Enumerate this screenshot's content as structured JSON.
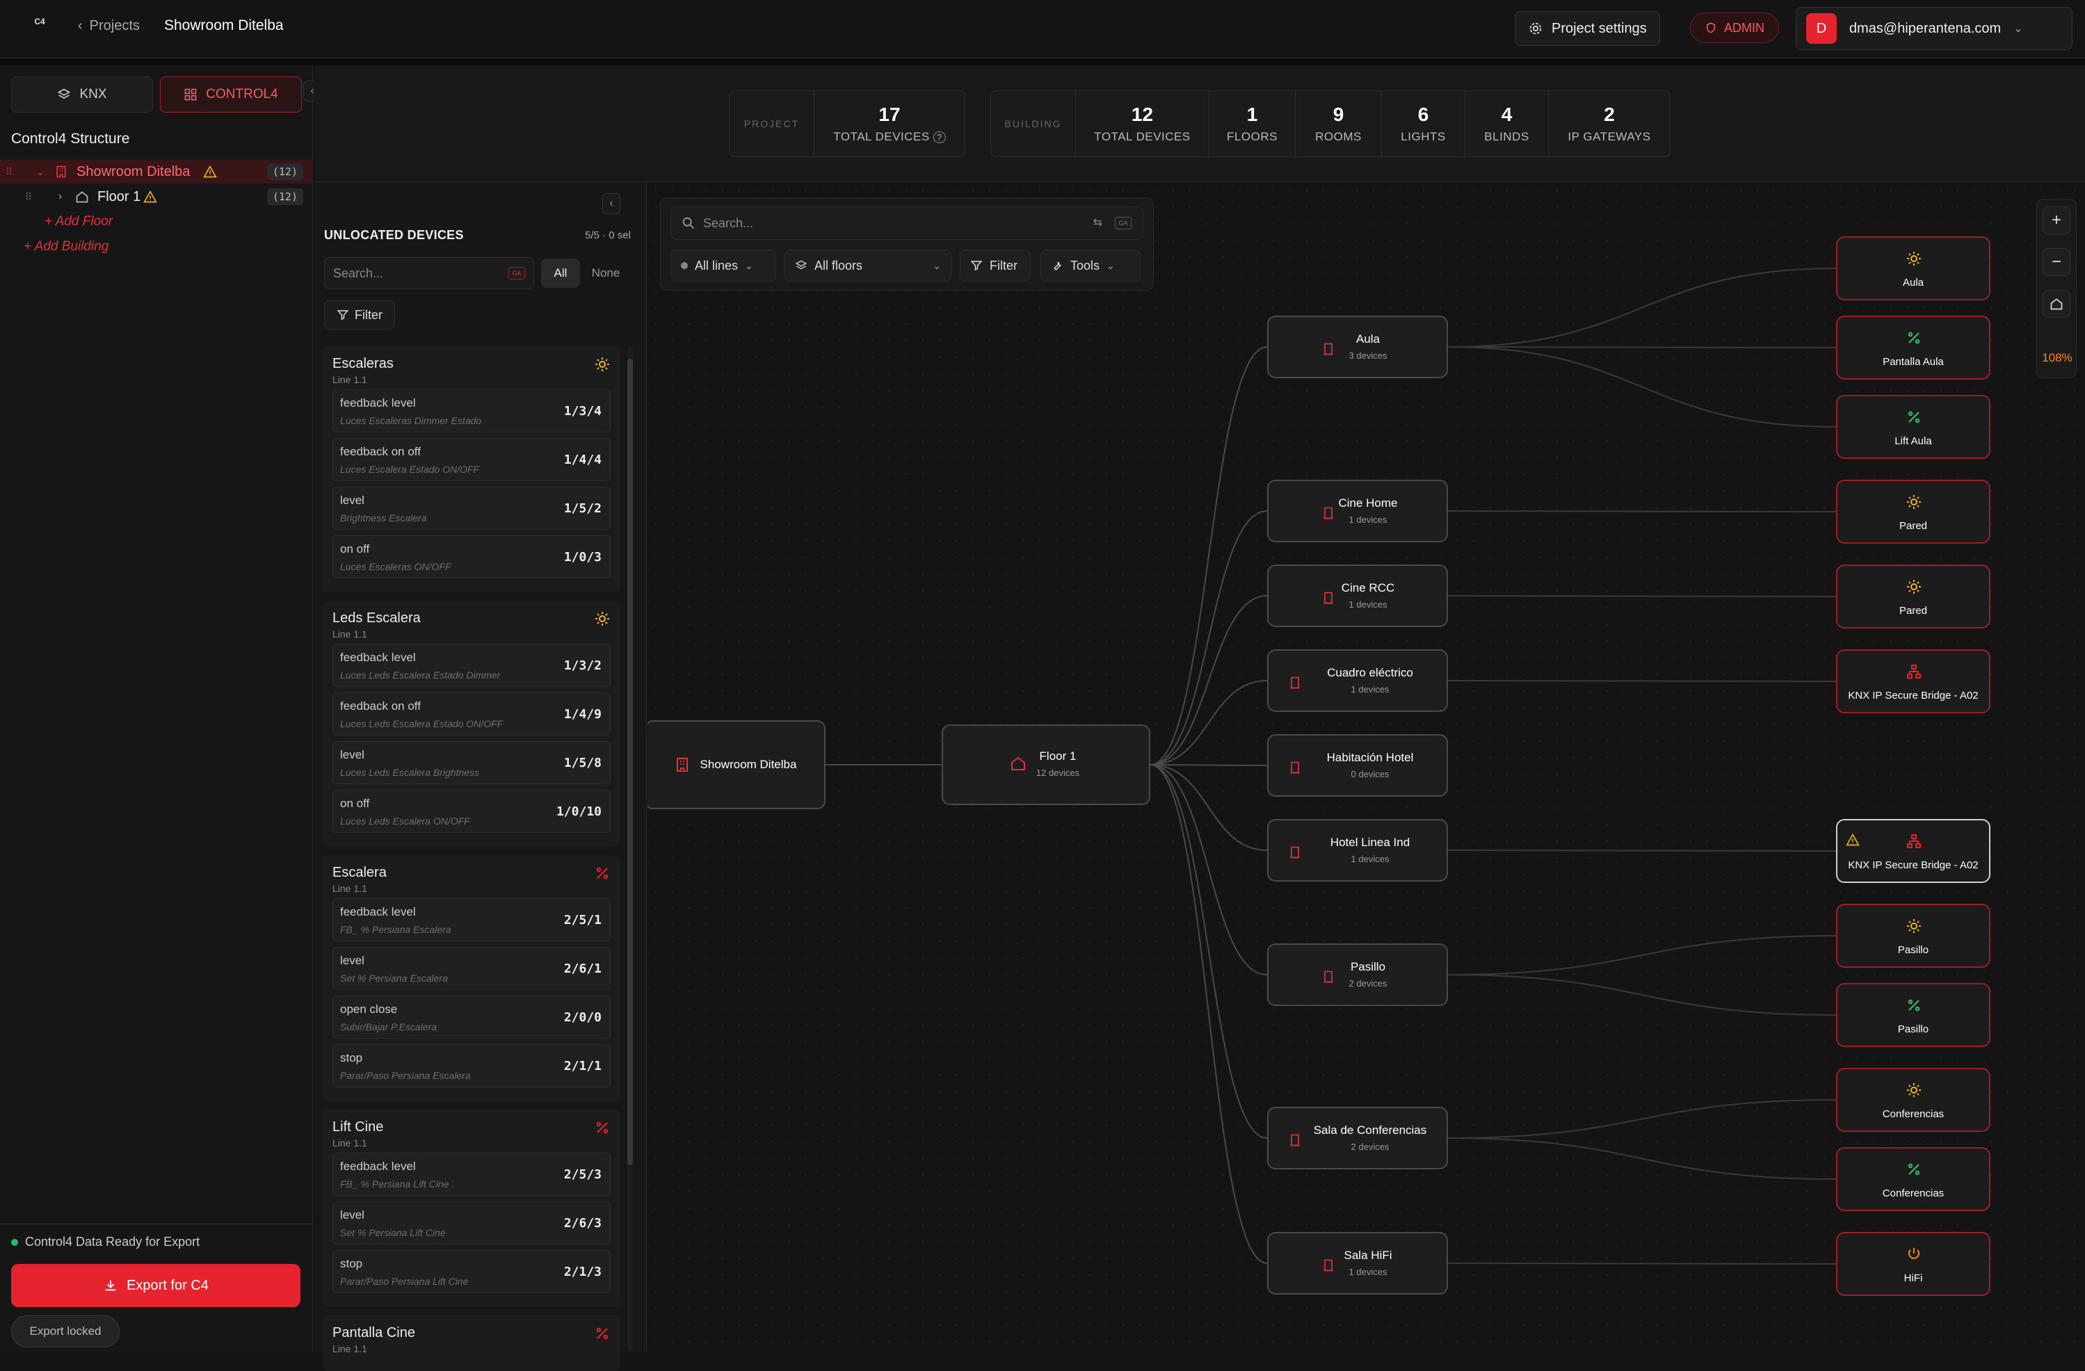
{
  "topbar": {
    "logo": "C4",
    "breadcrumb_link": "Projects",
    "project_title": "Showroom Ditelba",
    "settings_label": "Project settings",
    "role_badge": "ADMIN",
    "avatar_letter": "D",
    "user_email": "dmas@hiperantena.com"
  },
  "sidebar": {
    "tabs": [
      {
        "label": "KNX"
      },
      {
        "label": "CONTROL4"
      }
    ],
    "section_title": "Control4 Structure",
    "tree": [
      {
        "label": "Showroom Ditelba",
        "count": "(12)"
      },
      {
        "label": "Floor 1",
        "count": "(12)"
      }
    ],
    "add_floor": "+ Add Floor",
    "add_building": "+ Add Building",
    "ready_text": "Control4 Data Ready for Export",
    "export_label": "Export for C4",
    "locked_label": "Export locked"
  },
  "stats": {
    "project_label": "PROJECT",
    "project_total": {
      "value": "17",
      "caption": "TOTAL DEVICES"
    },
    "building_label": "BUILDING",
    "building": [
      {
        "value": "12",
        "caption": "TOTAL DEVICES"
      },
      {
        "value": "1",
        "caption": "FLOORS"
      },
      {
        "value": "9",
        "caption": "ROOMS"
      },
      {
        "value": "6",
        "caption": "LIGHTS"
      },
      {
        "value": "4",
        "caption": "BLINDS"
      },
      {
        "value": "2",
        "caption": "IP GATEWAYS"
      }
    ]
  },
  "unlocated": {
    "title": "UNLOCATED DEVICES",
    "selection": "5/5 · 0 sel",
    "search_placeholder": "Search...",
    "all_label": "All",
    "none_label": "None",
    "filter_label": "Filter",
    "groups": [
      {
        "name": "Escaleras",
        "line": "Line 1.1",
        "icon": "light-icon",
        "items": [
          {
            "title": "feedback level",
            "sub": "Luces Escaleras Dimmer Estado",
            "addr": "1/3/4"
          },
          {
            "title": "feedback on off",
            "sub": "Luces Escalera Estado ON/OFF",
            "addr": "1/4/4"
          },
          {
            "title": "level",
            "sub": "Brightness Escalera",
            "addr": "1/5/2"
          },
          {
            "title": "on off",
            "sub": "Luces Escaleras ON/OFF",
            "addr": "1/0/3"
          }
        ]
      },
      {
        "name": "Leds Escalera",
        "line": "Line 1.1",
        "icon": "light-icon",
        "items": [
          {
            "title": "feedback level",
            "sub": "Luces Leds Escalera Estado Dimmer",
            "addr": "1/3/2"
          },
          {
            "title": "feedback on off",
            "sub": "Luces Leds Escalera Estado ON/OFF",
            "addr": "1/4/9"
          },
          {
            "title": "level",
            "sub": "Luces Leds Escalera Brightness",
            "addr": "1/5/8"
          },
          {
            "title": "on off",
            "sub": "Luces Leds Escalera ON/OFF",
            "addr": "1/0/10"
          }
        ]
      },
      {
        "name": "Escalera",
        "line": "Line 1.1",
        "icon": "blind-icon",
        "items": [
          {
            "title": "feedback level",
            "sub": "FB_ % Persiana Escalera",
            "addr": "2/5/1"
          },
          {
            "title": "level",
            "sub": "Set % Persiana Escalera",
            "addr": "2/6/1"
          },
          {
            "title": "open close",
            "sub": "Subir/Bajar P.Escalera",
            "addr": "2/0/0"
          },
          {
            "title": "stop",
            "sub": "Parar/Paso Persiana Escalera",
            "addr": "2/1/1"
          }
        ]
      },
      {
        "name": "Lift Cine",
        "line": "Line 1.1",
        "icon": "blind-icon",
        "items": [
          {
            "title": "feedback level",
            "sub": "FB_ % Persiana Lift Cine",
            "addr": "2/5/3"
          },
          {
            "title": "level",
            "sub": "Set % Persiana Lift Cine",
            "addr": "2/6/3"
          },
          {
            "title": "stop",
            "sub": "Parar/Paso Persiana Lift Cine",
            "addr": "2/1/3"
          }
        ]
      },
      {
        "name": "Pantalla Cine",
        "line": "Line 1.1",
        "icon": "blind-icon",
        "items": []
      }
    ]
  },
  "canvas": {
    "search_placeholder": "Search...",
    "lines_filter": "All lines",
    "floors_filter": "All floors",
    "filter_label": "Filter",
    "tools_label": "Tools",
    "zoom": "108%",
    "building_node": "Showroom Ditelba",
    "floor_node": {
      "title": "Floor 1",
      "sub": "12 devices"
    },
    "rooms": [
      {
        "title": "Aula",
        "sub": "3 devices"
      },
      {
        "title": "Cine Home",
        "sub": "1 devices"
      },
      {
        "title": "Cine RCC",
        "sub": "1 devices"
      },
      {
        "title": "Cuadro eléctrico",
        "sub": "1 devices"
      },
      {
        "title": "Habitación Hotel",
        "sub": "0 devices"
      },
      {
        "title": "Hotel Linea Ind",
        "sub": "1 devices"
      },
      {
        "title": "Pasillo",
        "sub": "2 devices"
      },
      {
        "title": "Sala de Conferencias",
        "sub": "2 devices"
      },
      {
        "title": "Sala HiFi",
        "sub": "1 devices"
      }
    ],
    "devices": [
      {
        "title": "Aula",
        "icon": "light-icon"
      },
      {
        "title": "Pantalla Aula",
        "icon": "blind-icon"
      },
      {
        "title": "Lift Aula",
        "icon": "blind-icon"
      },
      {
        "title": "Pared",
        "icon": "light-icon"
      },
      {
        "title": "Pared",
        "icon": "light-icon"
      },
      {
        "title": "KNX IP Secure Bridge - A02",
        "icon": "gateway-icon"
      },
      {
        "title": "KNX IP Secure Bridge - A02",
        "icon": "gateway-icon",
        "warning": true
      },
      {
        "title": "Pasillo",
        "icon": "light-icon"
      },
      {
        "title": "Pasillo",
        "icon": "blind-icon"
      },
      {
        "title": "Conferencias",
        "icon": "light-icon"
      },
      {
        "title": "Conferencias",
        "icon": "blind-icon"
      },
      {
        "title": "HiFi",
        "icon": "power-icon"
      }
    ]
  },
  "colors": {
    "accent": "#e5242f",
    "light": "#f0b429",
    "blind": "#33c46a",
    "power": "#f08a1f",
    "warning": "#e8b51a"
  }
}
